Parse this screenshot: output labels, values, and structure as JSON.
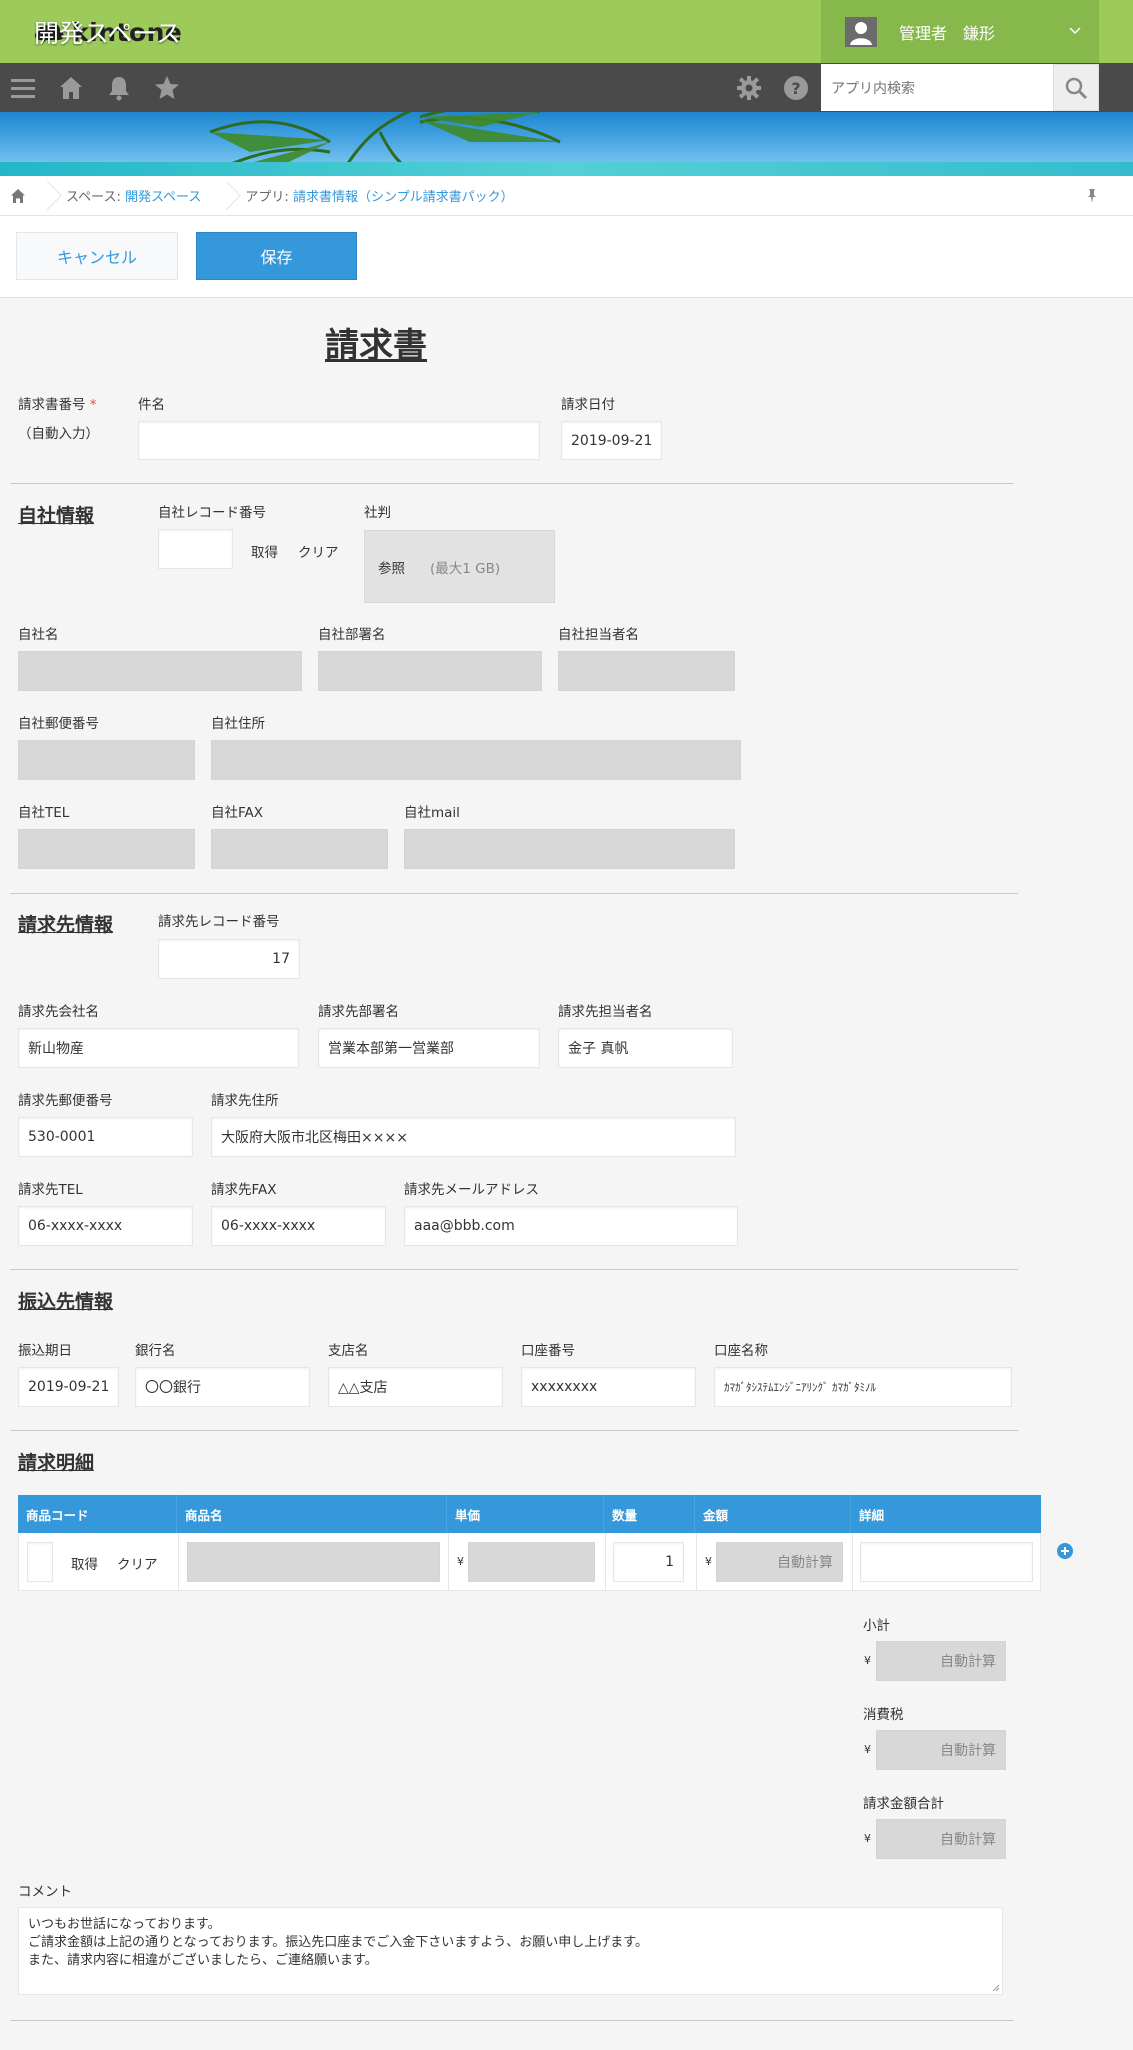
{
  "header": {
    "logo_text": "kintone",
    "user_name": "管理者　鎌形",
    "search_placeholder": "アプリ内検索"
  },
  "banner": {
    "space_title": "開発スペース"
  },
  "breadcrumb": {
    "space_prefix": "スペース:",
    "space_name": "開発スペース",
    "app_prefix": "アプリ:",
    "app_name": "請求書情報（シンプル請求書パック）"
  },
  "actions": {
    "cancel_label": "キャンセル",
    "save_label": "保存"
  },
  "form": {
    "title": "請求書",
    "invoice_number_label": "請求書番号",
    "required_mark": "*",
    "auto_input_note": "（自動入力）",
    "subject_label": "件名",
    "subject_value": "",
    "invoice_date_label": "請求日付",
    "invoice_date_value": "2019-09-21"
  },
  "own_company": {
    "section_title": "自社情報",
    "record_number_label": "自社レコード番号",
    "record_number_value": "",
    "fetch_label": "取得",
    "clear_label": "クリア",
    "seal_label": "社判",
    "browse_label": "参照",
    "max_size_note": "(最大1 GB)",
    "name_label": "自社名",
    "dept_label": "自社部署名",
    "person_label": "自社担当者名",
    "postal_label": "自社郵便番号",
    "address_label": "自社住所",
    "tel_label": "自社TEL",
    "fax_label": "自社FAX",
    "mail_label": "自社mail"
  },
  "client": {
    "section_title": "請求先情報",
    "record_number_label": "請求先レコード番号",
    "record_number_value": "17",
    "company_label": "請求先会社名",
    "company_value": "新山物産",
    "dept_label": "請求先部署名",
    "dept_value": "営業本部第一営業部",
    "person_label": "請求先担当者名",
    "person_value": "金子 真帆",
    "postal_label": "請求先郵便番号",
    "postal_value": "530-0001",
    "address_label": "請求先住所",
    "address_value": "大阪府大阪市北区梅田××××",
    "tel_label": "請求先TEL",
    "tel_value": "06-xxxx-xxxx",
    "fax_label": "請求先FAX",
    "fax_value": "06-xxxx-xxxx",
    "email_label": "請求先メールアドレス",
    "email_value": "aaa@bbb.com"
  },
  "transfer": {
    "section_title": "振込先情報",
    "due_label": "振込期日",
    "due_value": "2019-09-21",
    "bank_label": "銀行名",
    "bank_value": "〇〇銀行",
    "branch_label": "支店名",
    "branch_value": "△△支店",
    "account_no_label": "口座番号",
    "account_no_value": "xxxxxxxx",
    "account_name_label": "口座名称",
    "account_name_value": "ｶﾏｶﾞﾀｼｽﾃﾑｴﾝｼﾞﾆｱﾘﾝｸﾞ ｶﾏｶﾞﾀﾐﾉﾙ"
  },
  "details": {
    "section_title": "請求明細",
    "columns": [
      "商品コード",
      "商品名",
      "単価",
      "数量",
      "金額",
      "詳細"
    ],
    "row": {
      "fetch_label": "取得",
      "clear_label": "クリア",
      "yen": "¥",
      "quantity": "1",
      "amount": "自動計算"
    }
  },
  "totals": {
    "subtotal_label": "小計",
    "tax_label": "消費税",
    "total_label": "請求金額合計",
    "yen": "¥",
    "auto_calc": "自動計算"
  },
  "comment": {
    "label": "コメント",
    "line1": "いつもお世話になっております。",
    "line2": "ご請求金額は上記の通りとなっております。振込先口座までご入金下さいますよう、お願い申し上げます。",
    "line3": "また、請求内容に相違がございましたら、ご連絡願います。"
  },
  "colors": {
    "topbar": "#9ccb5a",
    "navbar": "#4a4a4a",
    "accent": "#3498db",
    "readonly": "#d8d8d8"
  }
}
